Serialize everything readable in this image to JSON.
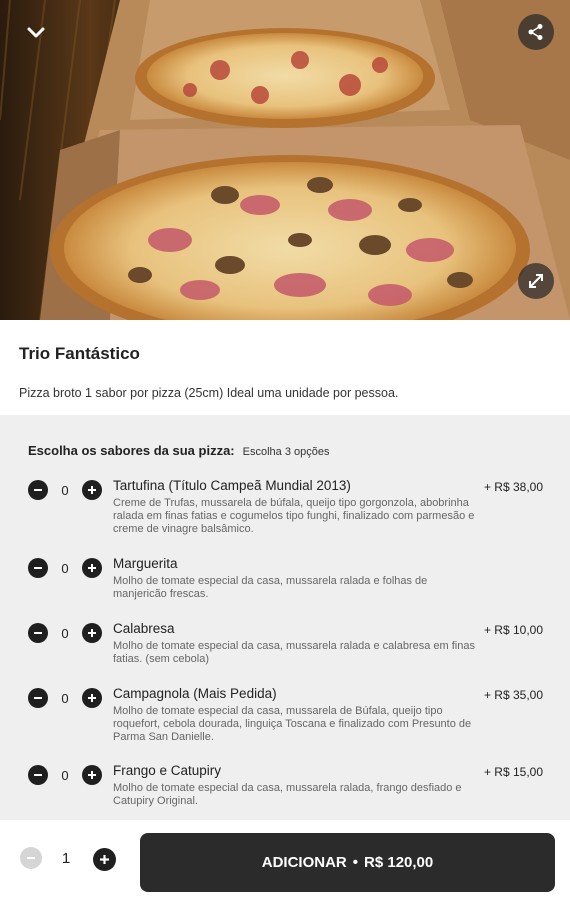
{
  "hero": {
    "image_alt": "pizzas em caixas",
    "back_icon": "chevron-down-icon",
    "share_icon": "share-icon",
    "expand_icon": "expand-icon"
  },
  "product": {
    "title": "Trio Fantástico",
    "description": "Pizza broto 1 sabor por pizza (25cm) Ideal uma unidade por pessoa."
  },
  "options": {
    "title": "Escolha os sabores da sua pizza:",
    "hint": "Escolha 3 opções",
    "items": [
      {
        "name": "Tartufina (Título Campeã Mundial 2013)",
        "price": "+ R$ 38,00",
        "qty": "0",
        "description": "Creme de Trufas, mussarela de búfala, queijo tipo gorgonzola, abobrinha ralada em finas fatias e cogumelos tipo funghi, finalizado com parmesão e creme de vinagre balsâmico."
      },
      {
        "name": "Marguerita",
        "price": "",
        "qty": "0",
        "description": "Molho de tomate especial da casa, mussarela ralada e folhas de manjericão frescas."
      },
      {
        "name": "Calabresa",
        "price": "+ R$ 10,00",
        "qty": "0",
        "description": "Molho de tomate especial da casa, mussarela ralada e calabresa em finas fatias. (sem cebola)"
      },
      {
        "name": "Campagnola (Mais Pedida)",
        "price": "+ R$ 35,00",
        "qty": "0",
        "description": "Molho de tomate especial da casa, mussarela de Búfala, queijo tipo roquefort, cebola dourada, linguiça Toscana e finalizado com Presunto de Parma San Danielle."
      },
      {
        "name": "Frango e Catupiry",
        "price": "+ R$ 15,00",
        "qty": "0",
        "description": "Molho de tomate especial da casa, mussarela ralada, frango desfiado e Catupiry Original."
      }
    ]
  },
  "cart": {
    "quantity": "1",
    "add_label": "ADICIONAR",
    "separator": "•",
    "total": "R$ 120,00"
  },
  "colors": {
    "dark": "#2b2b2b",
    "options_bg": "#efefef",
    "disabled": "#d5d5d5"
  }
}
